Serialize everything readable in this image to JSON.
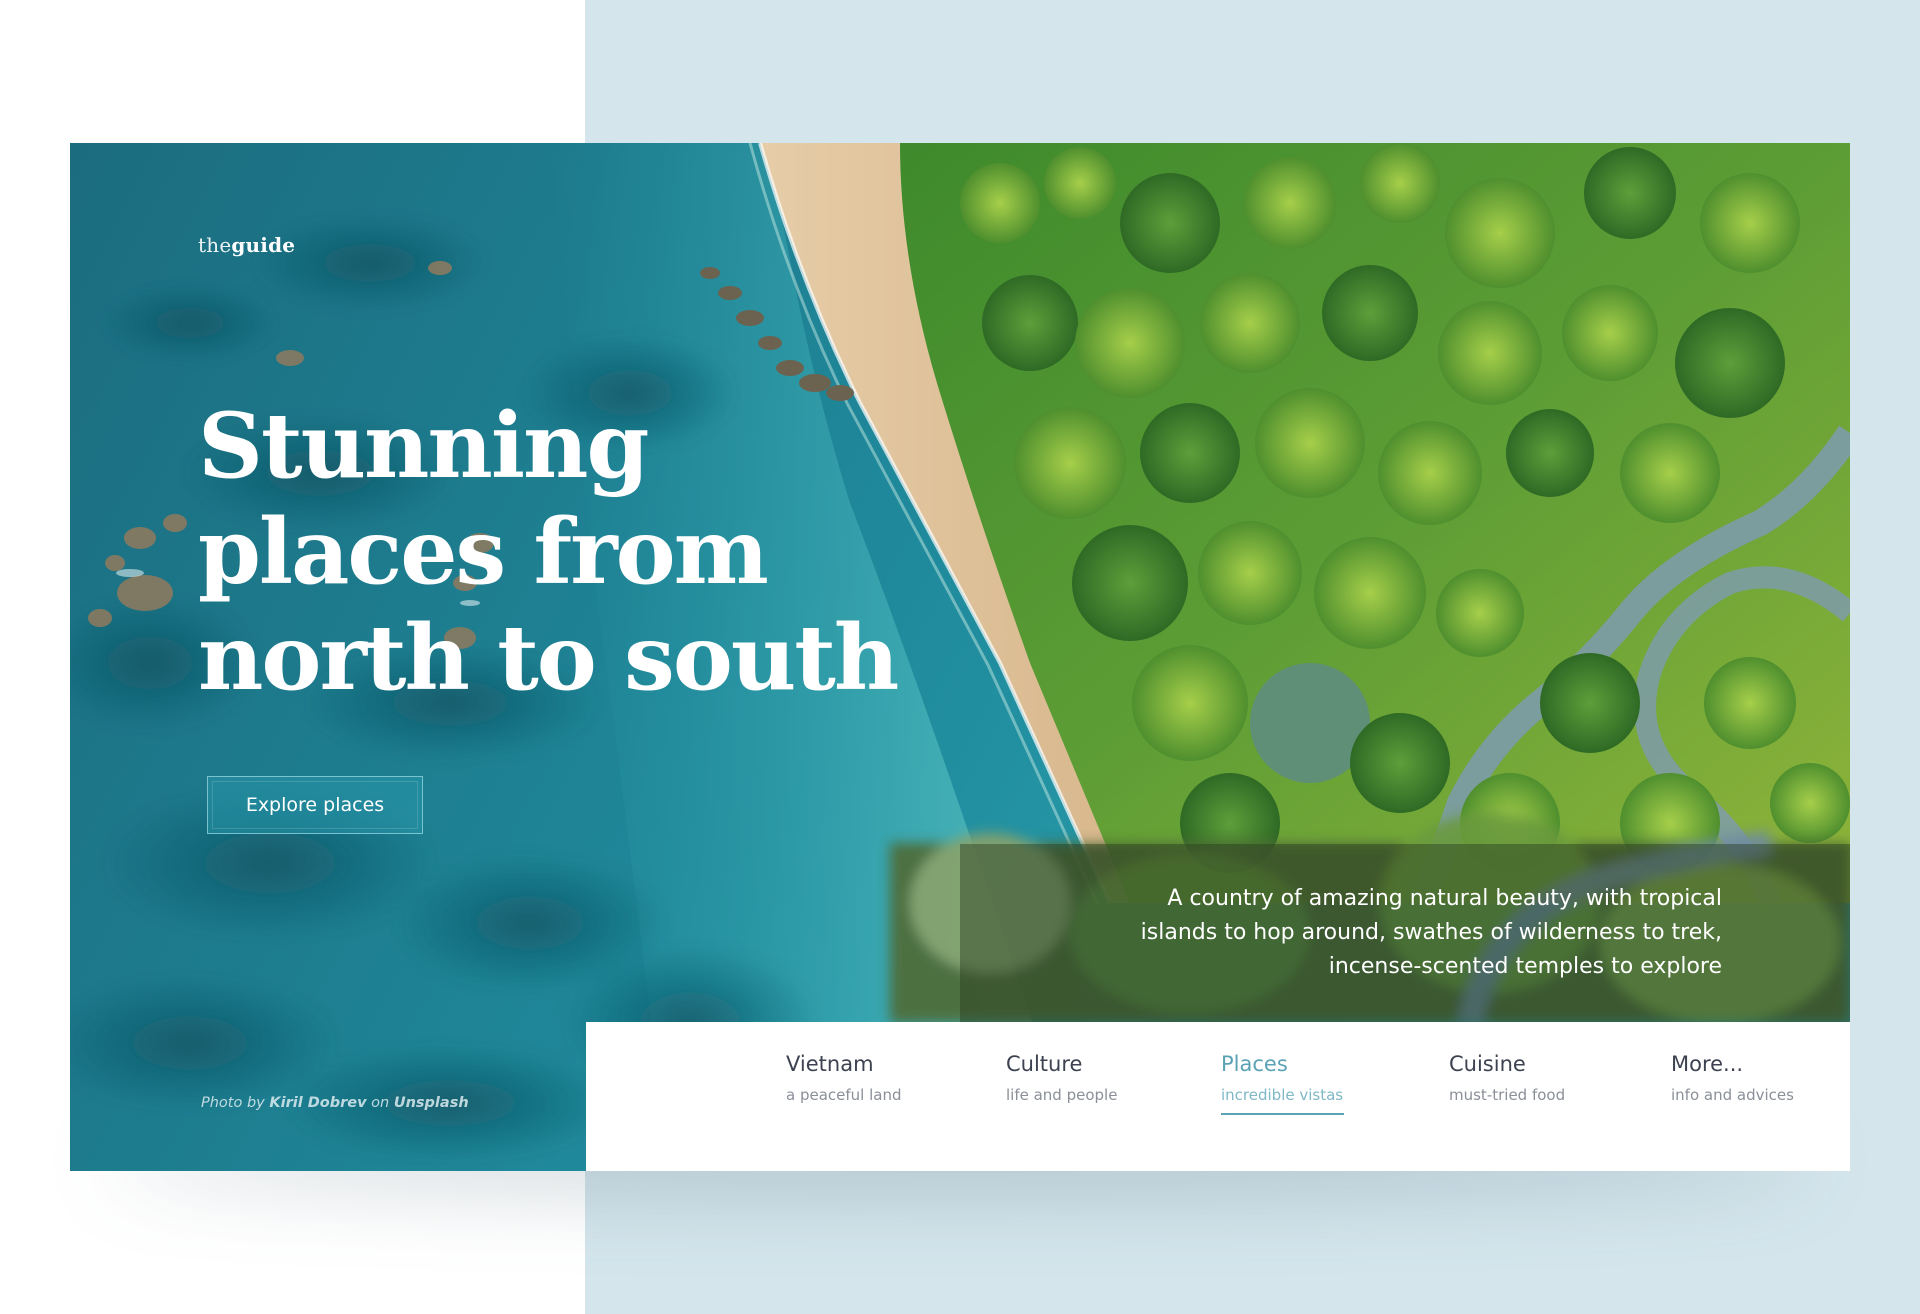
{
  "brand": {
    "logo_light": "the",
    "logo_bold": "guide"
  },
  "hero": {
    "headline_lines": [
      "Stunning",
      "places from",
      "north to south"
    ],
    "cta_label": "Explore places",
    "credit": {
      "prefix": "Photo by",
      "author": "Kiril Dobrev",
      "middle": "on",
      "source": "Unsplash"
    },
    "blurb_lines": [
      "A country of amazing natural beauty, with tropical",
      "islands to hop around, swathes of wilderness to trek,",
      "incense-scented temples to explore"
    ]
  },
  "nav": {
    "items": [
      {
        "title": "Vietnam",
        "subtitle": "a peaceful land",
        "active": false
      },
      {
        "title": "Culture",
        "subtitle": "life and people",
        "active": false
      },
      {
        "title": "Places",
        "subtitle": "incredible vistas",
        "active": true
      },
      {
        "title": "Cuisine",
        "subtitle": "must-tried food",
        "active": false
      },
      {
        "title": "More...",
        "subtitle": "info and advices",
        "active": false
      }
    ]
  },
  "colors": {
    "page_left": "#ffffff",
    "page_right": "#d4e5ec",
    "accent": "#5aa2b4",
    "nav_text": "#3c4250",
    "nav_subtext": "#8a8f98"
  },
  "icons": []
}
